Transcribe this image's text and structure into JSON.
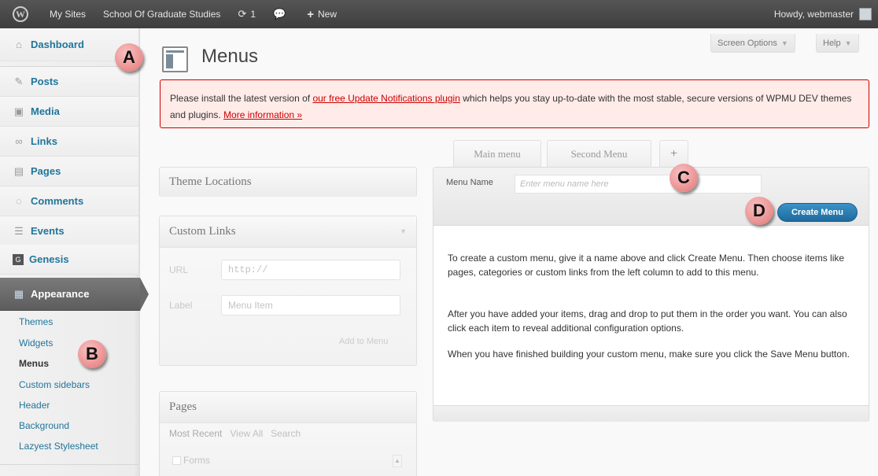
{
  "adminbar": {
    "wp_logo": "W",
    "my_sites": "My Sites",
    "site_name": "School Of Graduate Studies",
    "updates_icon": "refresh-icon",
    "updates_count": "1",
    "comments_icon": "comment-icon",
    "new_label": "New",
    "howdy": "Howdy, webmaster"
  },
  "sidebar": {
    "dashboard": "Dashboard",
    "posts": "Posts",
    "media": "Media",
    "links": "Links",
    "pages": "Pages",
    "comments": "Comments",
    "events": "Events",
    "genesis": "Genesis",
    "appearance": "Appearance",
    "submenu": {
      "themes": "Themes",
      "widgets": "Widgets",
      "menus": "Menus",
      "custom_sidebars": "Custom sidebars",
      "header": "Header",
      "background": "Background",
      "lazyest": "Lazyest Stylesheet"
    }
  },
  "header": {
    "title": "Menus",
    "screen_options": "Screen Options",
    "help": "Help"
  },
  "notice": {
    "before": "Please install the latest version of ",
    "link": "our free Update Notifications plugin",
    "after": " which helps you stay up-to-date with the most stable, secure versions of WPMU DEV themes and plugins. ",
    "more": "More information »"
  },
  "left_column": {
    "theme_locations": "Theme Locations",
    "custom_links": {
      "title": "Custom Links",
      "url_label": "URL",
      "url_value": "http://",
      "label_label": "Label",
      "label_placeholder": "Menu Item",
      "add_button": "Add to Menu"
    },
    "pages": {
      "title": "Pages",
      "tabs": [
        "Most Recent",
        "View All",
        "Search"
      ],
      "first_item": "Forms"
    }
  },
  "menu_tabs": {
    "tab1": "Main menu",
    "tab2": "Second Menu",
    "add": "+"
  },
  "menu_editor": {
    "name_label": "Menu Name",
    "name_placeholder": "Enter menu name here",
    "create_button": "Create Menu",
    "help_p1": "To create a custom menu, give it a name above and click Create Menu. Then choose items like pages, categories or custom links from the left column to add to this menu.",
    "help_p2": "After you have added your items, drag and drop to put them in the order you want. You can also click each item to reveal additional configuration options.",
    "help_p3": "When you have finished building your custom menu, make sure you click the Save Menu button."
  },
  "callouts": {
    "a": "A",
    "b": "B",
    "c": "C",
    "d": "D"
  },
  "colors": {
    "admin_bar": "#464646",
    "link": "#21759b",
    "notice_border": "#cc0000",
    "notice_bg": "#ffebe8",
    "create_button": "#2a7fb5",
    "callout": "#ee9898"
  }
}
